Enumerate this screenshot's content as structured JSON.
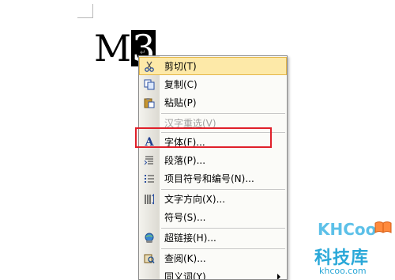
{
  "document": {
    "text_before": "M",
    "selected_text": "3",
    "para_mark": "↵"
  },
  "context_menu": {
    "items": [
      {
        "label": "剪切(T)",
        "icon": "scissors-icon",
        "enabled": true,
        "hover": true
      },
      {
        "label": "复制(C)",
        "icon": "copy-icon",
        "enabled": true
      },
      {
        "label": "粘贴(P)",
        "icon": "paste-icon",
        "enabled": true
      },
      {
        "label": "汉字重选(V)",
        "icon": "",
        "enabled": false
      },
      {
        "label": "字体(F)...",
        "icon": "font-icon",
        "enabled": true
      },
      {
        "label": "段落(P)...",
        "icon": "paragraph-icon",
        "enabled": true
      },
      {
        "label": "项目符号和编号(N)...",
        "icon": "bullets-icon",
        "enabled": true
      },
      {
        "label": "文字方向(X)...",
        "icon": "text-direction-icon",
        "enabled": true
      },
      {
        "label": "符号(S)...",
        "icon": "",
        "enabled": true
      },
      {
        "label": "超链接(H)...",
        "icon": "hyperlink-icon",
        "enabled": true
      },
      {
        "label": "查阅(K)...",
        "icon": "research-icon",
        "enabled": true
      },
      {
        "label": "同义词(Y)",
        "icon": "",
        "enabled": true,
        "submenu": true
      }
    ]
  },
  "annotation": {
    "highlight_color": "#e0202a"
  },
  "watermark": {
    "logo": "KHCoo",
    "name": "科技库",
    "url": "khcoo.com"
  }
}
